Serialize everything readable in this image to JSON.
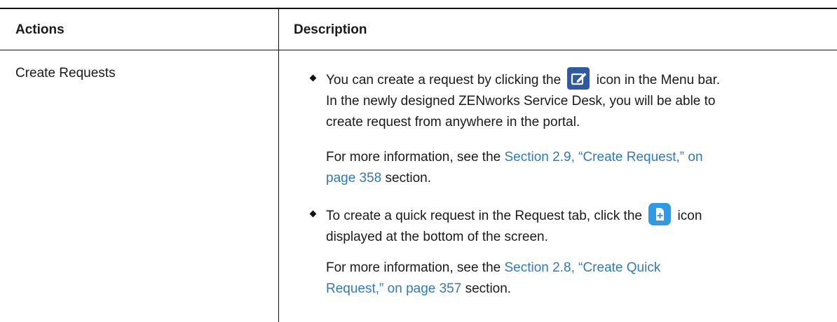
{
  "table": {
    "headers": {
      "actions": "Actions",
      "description": "Description"
    },
    "row": {
      "action": "Create Requests",
      "bullet1": {
        "text_before_icon": "You can create a request by clicking the",
        "icon": "edit-request-icon",
        "line1_after_icon": "icon in the Menu bar.",
        "line2": "In the newly designed ZENworks Service Desk, you will be able to",
        "line3": "create request from anywhere in the portal.",
        "more_prefix": "For more information, see the",
        "link_line1": "Section 2.9, “Create Request,” on",
        "link_line2": "page 358",
        "more_suffix": "section."
      },
      "bullet2": {
        "text_before_icon": "To create a quick request in the Request tab, click the",
        "icon": "quick-request-icon",
        "text_after_icon": "icon",
        "line2": "displayed at the bottom of the screen.",
        "more_prefix": "For more information, see the",
        "link_line1": "Section 2.8, “Create Quick",
        "link_line2": "Request,” on page 357",
        "more_suffix": "section."
      }
    }
  },
  "colors": {
    "link": "#2f78c4",
    "edit_icon_bg": "#2d5aa0",
    "quick_icon_bg": "#2f9be6"
  }
}
